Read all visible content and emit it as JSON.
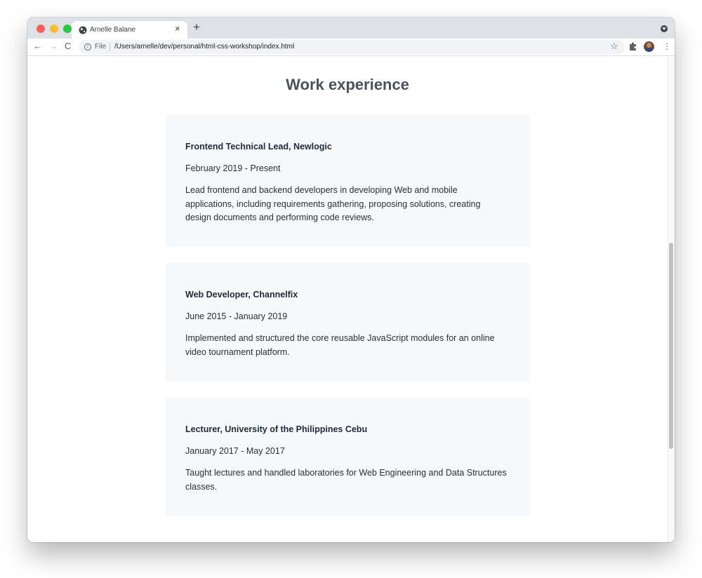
{
  "browser": {
    "tab_title": "Arnelle Balane",
    "new_tab_symbol": "+",
    "close_symbol": "×",
    "nav_back_symbol": "←",
    "nav_forward_symbol": "→",
    "reload_symbol": "C",
    "info_symbol": "i",
    "address_scheme": "File",
    "address_url": "/Users/arnelle/dev/personal/html-css-workshop/index.html",
    "star_symbol": "☆",
    "menu_symbol": "⋮"
  },
  "page": {
    "heading": "Work experience",
    "jobs": [
      {
        "title": "Frontend Technical Lead, Newlogic",
        "dates": "February 2019 - Present",
        "description": "Lead frontend and backend developers in developing Web and mobile applications, including requirements gathering, proposing solutions, creating design documents and performing code reviews."
      },
      {
        "title": "Web Developer, Channelfix",
        "dates": "June 2015 - January 2019",
        "description": "Implemented and structured the core reusable JavaScript modules for an online video tournament platform."
      },
      {
        "title": "Lecturer, University of the Philippines Cebu",
        "dates": "January 2017 - May 2017",
        "description": "Taught lectures and handled laboratories for Web Engineering and Data Structures classes."
      }
    ]
  },
  "colors": {
    "card_background": "#f7f8fa",
    "heading": "#4a5159",
    "tabstrip": "#dee1e6"
  }
}
